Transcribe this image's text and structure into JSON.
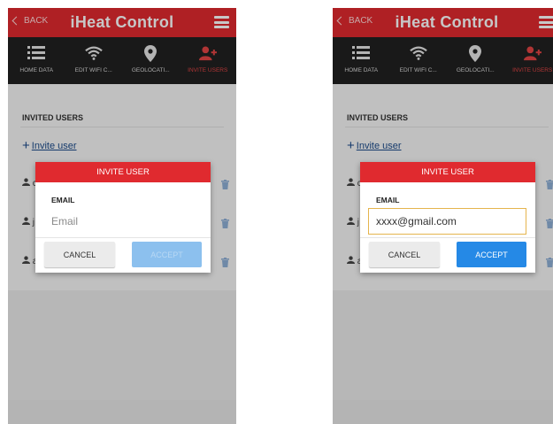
{
  "app": {
    "title": "iHeat Control",
    "back_label": "BACK"
  },
  "nav": [
    {
      "label": "HOME DATA",
      "icon": "list-icon"
    },
    {
      "label": "EDIT WIFI C...",
      "icon": "wifi-icon"
    },
    {
      "label": "GEOLOCATI...",
      "icon": "location-pin-icon"
    },
    {
      "label": "INVITE USERS",
      "icon": "add-user-icon",
      "active": true
    }
  ],
  "section": {
    "title": "INVITED USERS",
    "invite_label": "Invite user"
  },
  "users": [
    {
      "initial": "c"
    },
    {
      "initial": "j"
    },
    {
      "initial": "a"
    }
  ],
  "screens": [
    {
      "dialog": {
        "title": "INVITE USER",
        "email_label": "EMAIL",
        "email_placeholder": "Email",
        "email_value": "",
        "cancel_label": "CANCEL",
        "accept_label": "ACCEPT",
        "accept_enabled": false
      }
    },
    {
      "dialog": {
        "title": "INVITE USER",
        "email_label": "EMAIL",
        "email_placeholder": "Email",
        "email_value": "xxxx@gmail.com",
        "cancel_label": "CANCEL",
        "accept_label": "ACCEPT",
        "accept_enabled": true
      }
    }
  ],
  "colors": {
    "brand_red": "#e02a2f",
    "nav_dark": "#202020",
    "accept_blue": "#2589e6",
    "accept_disabled": "#8cc0ee",
    "focus_border": "#e5b54d",
    "link_blue": "#1a4a8a"
  }
}
